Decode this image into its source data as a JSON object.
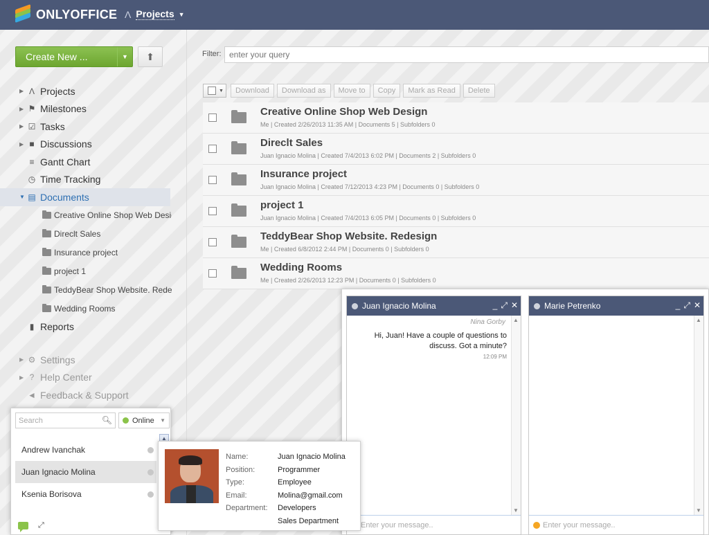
{
  "header": {
    "logo_text": "ONLYOFFICE",
    "product_label": "Projects"
  },
  "sidebar": {
    "create_label": "Create New ...",
    "nav_main": [
      {
        "label": "Projects",
        "icon": "projects-icon",
        "glyph": "Λ"
      },
      {
        "label": "Milestones",
        "icon": "flag-icon",
        "glyph": "⚑"
      },
      {
        "label": "Tasks",
        "icon": "checkbox-icon",
        "glyph": "☑"
      },
      {
        "label": "Discussions",
        "icon": "discussion-icon",
        "glyph": "■"
      },
      {
        "label": "Gantt Chart",
        "icon": "gantt-icon",
        "glyph": "≡"
      },
      {
        "label": "Time Tracking",
        "icon": "clock-icon",
        "glyph": "◷"
      },
      {
        "label": "Documents",
        "icon": "documents-icon",
        "glyph": "▤"
      }
    ],
    "doc_folders": [
      "Creative Online Shop Web Desig",
      "Direclt Sales",
      "Insurance project",
      "project 1",
      "TeddyBear Shop Website. Redes",
      "Wedding Rooms"
    ],
    "reports_label": "Reports",
    "nav_bottom": [
      {
        "label": "Settings",
        "icon": "gear-icon",
        "glyph": "⚙"
      },
      {
        "label": "Help Center",
        "icon": "help-icon",
        "glyph": "?"
      },
      {
        "label": "Feedback & Support",
        "icon": "megaphone-icon",
        "glyph": "◄"
      }
    ]
  },
  "filter": {
    "label": "Filter:",
    "placeholder": "enter your query"
  },
  "toolbar": {
    "buttons": [
      "Download",
      "Download as",
      "Move to",
      "Copy",
      "Mark as Read",
      "Delete"
    ]
  },
  "documents": [
    {
      "title": "Creative Online Shop Web Design",
      "meta": "Me  |  Created 2/26/2013 11:35 AM  |  Documents 5  |  Subfolders 0"
    },
    {
      "title": "Direclt Sales",
      "meta": "Juan Ignacio Molina  |  Created 7/4/2013 6:02 PM  |  Documents 2  |  Subfolders 0"
    },
    {
      "title": "Insurance project",
      "meta": "Juan Ignacio Molina  |  Created 7/12/2013 4:23 PM  |  Documents 0  |  Subfolders 0"
    },
    {
      "title": "project 1",
      "meta": "Juan Ignacio Molina  |  Created 7/4/2013 6:05 PM  |  Documents 0  |  Subfolders 0"
    },
    {
      "title": "TeddyBear Shop Website. Redesign",
      "meta": "Me  |  Created 6/8/2012 2:44 PM  |  Documents 0  |  Subfolders 0"
    },
    {
      "title": "Wedding Rooms",
      "meta": "Me  |  Created 2/26/2013 12:23 PM  |  Documents 0  |  Subfolders 0"
    }
  ],
  "contacts": {
    "search_placeholder": "Search",
    "status": "Online",
    "people": [
      "Andrew Ivanchak",
      "Juan Ignacio Molina",
      "Ksenia Borisova"
    ]
  },
  "person_card": {
    "fields": [
      {
        "key": "Name:",
        "value": "Juan Ignacio Molina"
      },
      {
        "key": "Position:",
        "value": "Programmer"
      },
      {
        "key": "Type:",
        "value": "Employee"
      },
      {
        "key": "Email:",
        "value": "Molina@gmail.com"
      },
      {
        "key": "Department:",
        "value": "Developers"
      },
      {
        "key": "",
        "value": "Sales Department"
      }
    ]
  },
  "chats": [
    {
      "name": "Juan Ignacio Molina",
      "messages": [
        {
          "sender": "Nina Gorby",
          "text": "Hi, Juan! Have a couple of questions to discuss. Got a minute?",
          "time": "12:09 PM"
        }
      ],
      "input_placeholder": "Enter your message.."
    },
    {
      "name": "Marie Petrenko",
      "messages": [],
      "input_placeholder": "Enter your message.."
    }
  ]
}
